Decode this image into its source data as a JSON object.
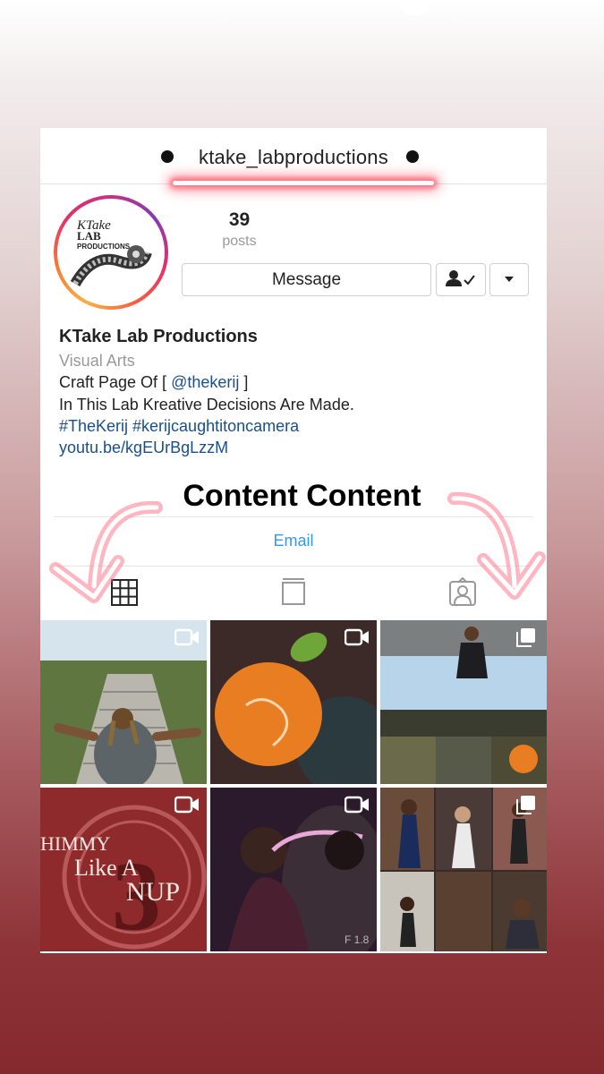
{
  "profile": {
    "username": "ktake_labproductions",
    "posts_count": "39",
    "posts_label": "posts",
    "name": "KTake Lab Productions",
    "category": "Visual Arts",
    "bio_line1_prefix": "Craft Page Of [ ",
    "bio_line1_mention": "@thekerij",
    "bio_line1_suffix": " ]",
    "bio_line2": "In This Lab Kreative Decisions Are Made.",
    "bio_hashtags": "#TheKerij #kerijcaughtitoncamera",
    "bio_link": "youtu.be/kgEUrBgLzzM",
    "avatar_text_line1": "KTake",
    "avatar_text_line2": "LAB",
    "avatar_text_line3": "PRODUCTIONS"
  },
  "actions": {
    "message_label": "Message",
    "follow_icon": "person-check-icon",
    "more_icon": "chevron-down-icon",
    "email_label": "Email"
  },
  "overlay": {
    "content_heading": "Content Content"
  },
  "tabs": [
    {
      "name": "grid-icon",
      "active": true
    },
    {
      "name": "book-icon",
      "active": false
    },
    {
      "name": "tagged-icon",
      "active": false
    }
  ],
  "posts": [
    {
      "type": "video",
      "subject": "stairs-photo",
      "icon": "video-icon"
    },
    {
      "type": "video",
      "subject": "peach-sign-photo",
      "icon": "video-icon"
    },
    {
      "type": "carousel",
      "subject": "court-pose-photo",
      "icon": "carousel-icon"
    },
    {
      "type": "video",
      "subject": "shimmy-title-card",
      "icon": "video-icon",
      "caption_line1": "HIMMY",
      "caption_line2": "Like A",
      "caption_line3": "NUP",
      "number": "3"
    },
    {
      "type": "video",
      "subject": "singers-photo",
      "icon": "video-icon",
      "corner_text": "F 1.8"
    },
    {
      "type": "carousel",
      "subject": "graduation-collage",
      "icon": "carousel-icon"
    }
  ],
  "colors": {
    "accent_blue": "#3897f0",
    "link_blue": "#1a4f8a",
    "glow": "#ff6b7d"
  }
}
